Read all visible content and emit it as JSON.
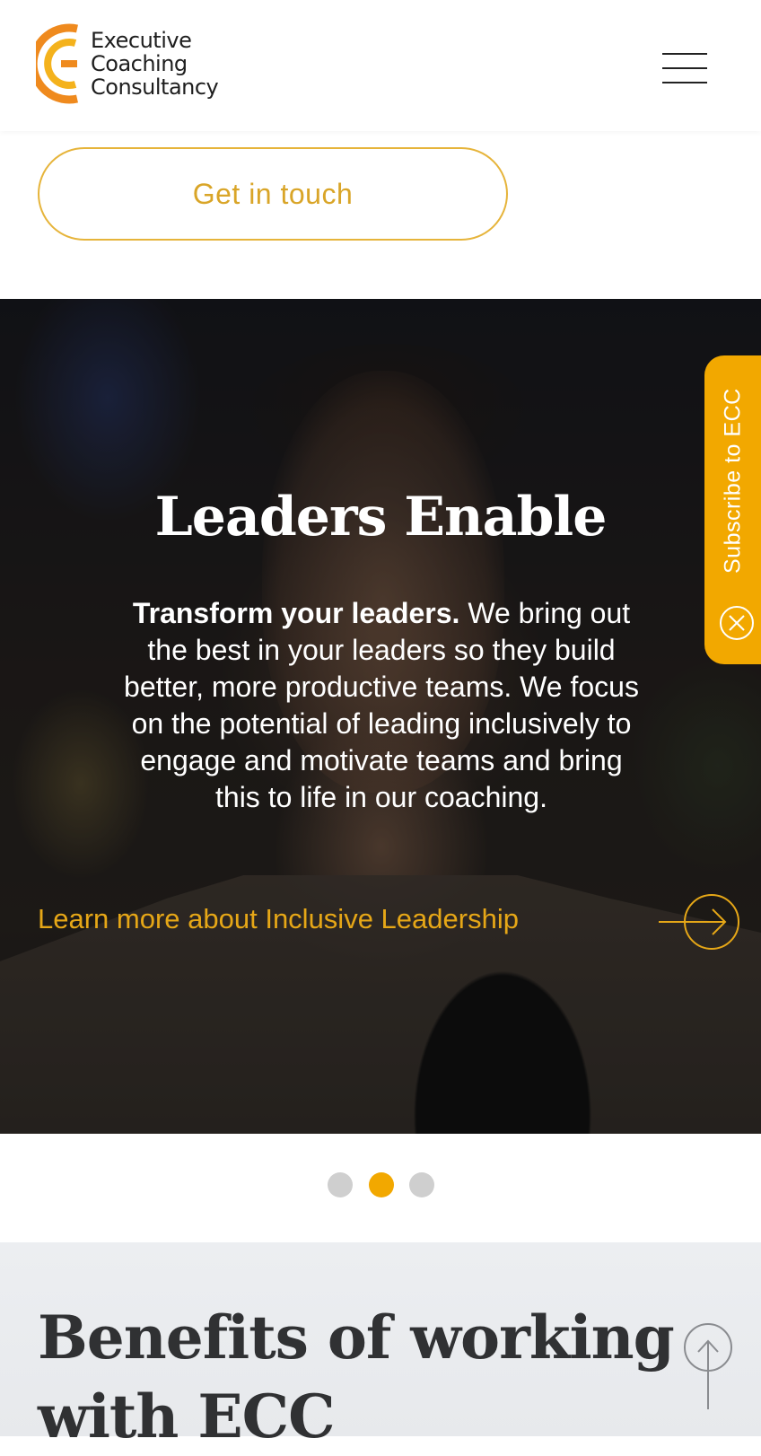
{
  "header": {
    "logo": {
      "line1": "Executive",
      "line2": "Coaching",
      "line3": "Consultancy"
    },
    "menu_icon": "hamburger-menu-icon"
  },
  "cta": {
    "label": "Get in touch"
  },
  "hero": {
    "title": "Leaders Enable",
    "body_bold": "Transform your leaders.",
    "body_text": " We bring out the best in your leaders so they build better, more productive teams. We focus on the potential of leading inclusively to engage and motivate teams and bring this to life in our coaching.",
    "link_label": "Learn more about Inclusive Leadership",
    "link_icon": "arrow-right-circle-icon"
  },
  "subscribe": {
    "label": "Subscribe to ECC",
    "close_icon": "close-circle-icon"
  },
  "carousel": {
    "slide_count": 3,
    "active_index": 1
  },
  "benefits": {
    "title": "Benefits of working with ECC"
  },
  "scroll_top_icon": "arrow-up-circle-icon",
  "colors": {
    "accent": "#f2a800",
    "cta_border": "#e6b43a",
    "logo_orange": "#ef8a1e",
    "logo_yellow": "#f4b21c",
    "text_dark": "#303133"
  }
}
